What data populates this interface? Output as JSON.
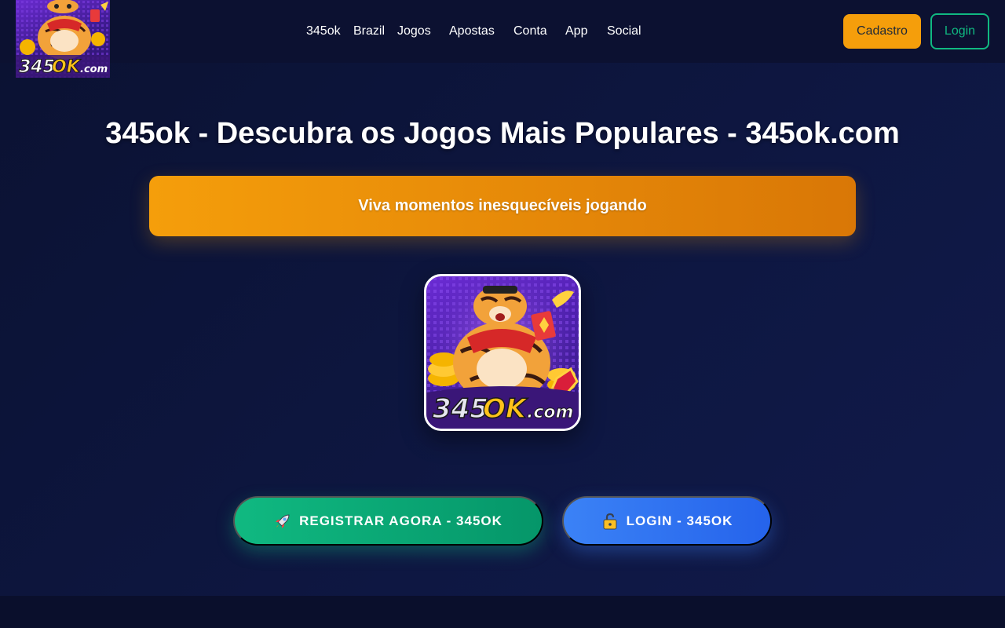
{
  "brand": {
    "logo_text": "345OK.com",
    "logo_main": "345OK",
    "logo_suffix": ".com"
  },
  "nav": {
    "items": [
      "345ok",
      "Brazil",
      "Jogos",
      "Apostas",
      "Conta",
      "App",
      "Social"
    ]
  },
  "header_actions": {
    "cadastro_label": "Cadastro",
    "login_label": "Login"
  },
  "hero": {
    "title": "345ok - Descubra os Jogos Mais Populares - 345ok.com",
    "banner_text": "Viva momentos inesquecíveis jogando",
    "register_label": "REGISTRAR AGORA - 345OK",
    "login_label": "LOGIN - 345OK",
    "register_icon": "rocket-icon",
    "login_icon": "lock-icon"
  },
  "colors": {
    "background": "#0b1030",
    "accent_orange": "#f59e0b",
    "accent_green": "#10b981",
    "accent_blue": "#3b82f6"
  }
}
